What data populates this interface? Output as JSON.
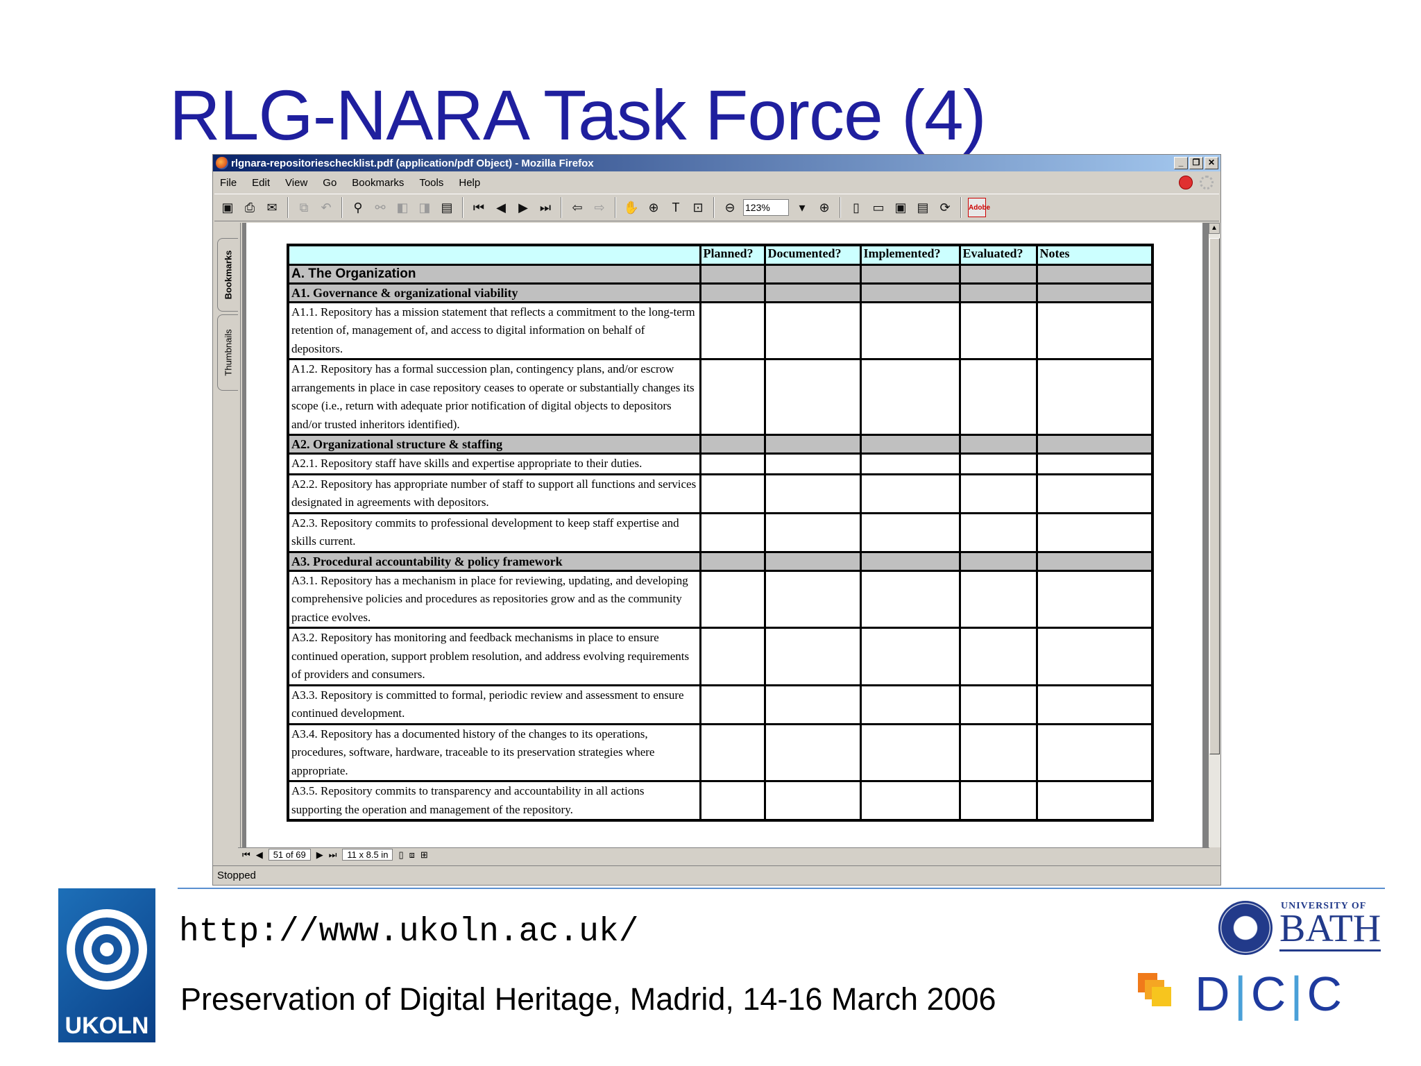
{
  "slide": {
    "title": "RLG-NARA Task Force (4)"
  },
  "browser": {
    "window_title": "rlgnara-repositorieschecklist.pdf (application/pdf Object) - Mozilla Firefox",
    "window_buttons": [
      "_",
      "❐",
      "✕"
    ],
    "menu": [
      "File",
      "Edit",
      "View",
      "Go",
      "Bookmarks",
      "Tools",
      "Help"
    ],
    "zoom": "123%",
    "side_tabs": [
      "Bookmarks",
      "Thumbnails"
    ],
    "page_indicator": "51 of 69",
    "page_size": "11 x 8.5 in",
    "status": "Stopped"
  },
  "checklist": {
    "headers": [
      "",
      "Planned?",
      "Documented?",
      "Implemented?",
      "Evaluated?",
      "Notes"
    ],
    "rows": [
      {
        "type": "section",
        "text": "A. The Organization"
      },
      {
        "type": "subsection",
        "text": "A1. Governance & organizational viability"
      },
      {
        "type": "item",
        "text": "A1.1. Repository has a mission statement that reflects a commitment to the long-term retention of, management of, and access to digital information on behalf of depositors."
      },
      {
        "type": "item",
        "text": "A1.2. Repository has a formal succession plan, contingency plans, and/or escrow arrangements in place in case repository ceases to operate or substantially changes its scope (i.e., return with adequate prior notification of digital objects to depositors and/or trusted inheritors identified)."
      },
      {
        "type": "subsection",
        "text": "A2. Organizational structure & staffing"
      },
      {
        "type": "item",
        "text": "A2.1. Repository staff have skills and expertise appropriate to their duties."
      },
      {
        "type": "item",
        "text": "A2.2. Repository has appropriate number of staff to support all functions and services designated in agreements with depositors."
      },
      {
        "type": "item",
        "text": "A2.3. Repository commits to professional development to keep staff expertise and skills current."
      },
      {
        "type": "subsection",
        "text": "A3. Procedural accountability & policy framework"
      },
      {
        "type": "item",
        "text": "A3.1. Repository has a mechanism in place for reviewing, updating, and developing comprehensive policies and procedures as repositories grow and as the community practice evolves."
      },
      {
        "type": "item",
        "text": "A3.2. Repository has monitoring and feedback mechanisms in place to ensure continued operation, support problem resolution, and address evolving requirements of providers and consumers."
      },
      {
        "type": "item",
        "text": "A3.3. Repository is committed to formal, periodic review and assessment to ensure continued development."
      },
      {
        "type": "item",
        "text": "A3.4. Repository has a documented history of the changes to its operations, procedures, software, hardware, traceable to its preservation strategies where appropriate."
      },
      {
        "type": "item",
        "text": "A3.5. Repository commits to transparency and accountability in all actions supporting the operation and management of the repository."
      }
    ]
  },
  "footer": {
    "url": "http://www.ukoln.ac.uk/",
    "event": "Preservation of Digital Heritage, Madrid, 14-16 March 2006",
    "ukoln_label": "UKOLN",
    "bath_university": "UNIVERSITY OF",
    "bath_name": "BATH",
    "dcc_letters": "D|C|C"
  },
  "colors": {
    "title": "#1f1f9e",
    "table_header": "#ccffff",
    "section_row": "#c0c0c0",
    "footer_rule": "#5a8fd0",
    "dcc_blue": "#1e3a9e"
  }
}
